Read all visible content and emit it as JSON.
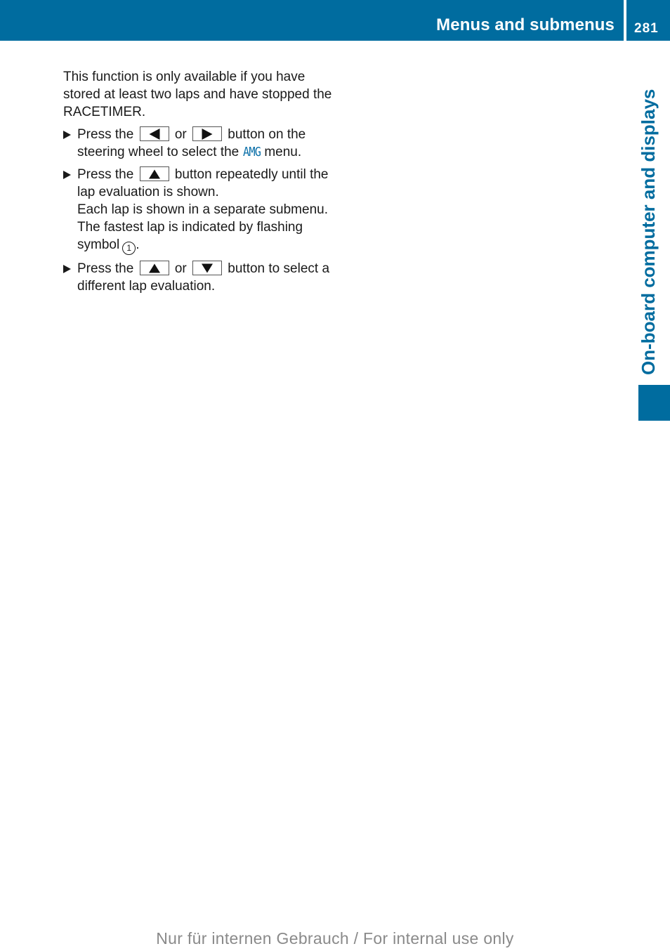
{
  "header": {
    "title": "Menus and submenus",
    "page_number": "281",
    "brand_color": "#006c9f"
  },
  "side_tab": {
    "label": "On-board computer and displays"
  },
  "content": {
    "intro": "This function is only available if you have stored at least two laps and have stopped the RACETIMER.",
    "steps": [
      {
        "icon": "bullet-arrow-icon",
        "before": "Press the",
        "key1": "left-arrow-button",
        "connector": "or",
        "key2": "right-arrow-button",
        "after_1": "button on the steering wheel to select the",
        "menu_name": "AMG",
        "after_2": "menu."
      },
      {
        "icon": "bullet-arrow-icon",
        "before": "Press the",
        "key1": "up-arrow-button",
        "after_1": "button repeatedly until the lap evaluation is shown.",
        "line2": "Each lap is shown in a separate submenu.",
        "line3_before": "The fastest lap is indicated by flashing symbol",
        "symbol": "1",
        "line3_after": "."
      },
      {
        "icon": "bullet-arrow-icon",
        "before": "Press the",
        "key1": "up-arrow-button",
        "connector": "or",
        "key2": "down-arrow-button",
        "after_1": "button to select a different lap evaluation."
      }
    ]
  },
  "footer": {
    "watermark": "Nur für internen Gebrauch / For internal use only"
  }
}
